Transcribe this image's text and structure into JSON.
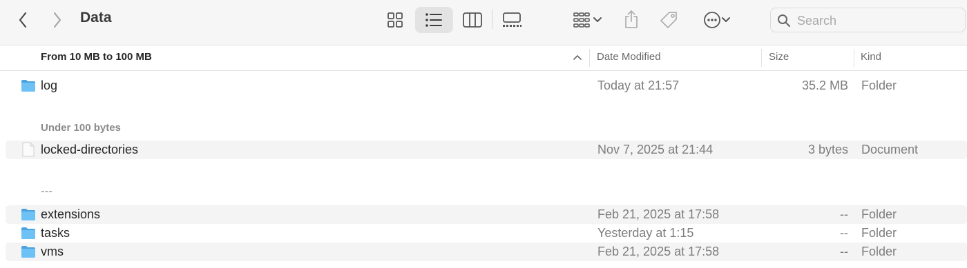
{
  "window": {
    "title": "Data"
  },
  "search": {
    "placeholder": "Search"
  },
  "columns": {
    "name": "From 10 MB to 100 MB",
    "date": "Date Modified",
    "size": "Size",
    "kind": "Kind"
  },
  "groups": {
    "first": {
      "label": "From 10 MB to 100 MB"
    },
    "second": {
      "label": "Under 100 bytes"
    },
    "third": {
      "label": "---"
    }
  },
  "rows": [
    {
      "name": "log",
      "date": "Today at 21:57",
      "size": "35.2 MB",
      "kind": "Folder",
      "icon": "folder-icon"
    },
    {
      "name": "locked-directories",
      "date": "Nov 7, 2025 at 21:44",
      "size": "3 bytes",
      "kind": "Document",
      "icon": "document-icon"
    },
    {
      "name": "extensions",
      "date": "Feb 21, 2025 at 17:58",
      "size": "--",
      "kind": "Folder",
      "icon": "folder-icon"
    },
    {
      "name": "tasks",
      "date": "Yesterday at 1:15",
      "size": "--",
      "kind": "Folder",
      "icon": "folder-icon"
    },
    {
      "name": "vms",
      "date": "Feb 21, 2025 at 17:58",
      "size": "--",
      "kind": "Folder",
      "icon": "folder-icon"
    }
  ],
  "colors": {
    "folder": "#5ab4f0",
    "accent": "#3a3a3a",
    "row_alt": "#f4f4f4"
  }
}
